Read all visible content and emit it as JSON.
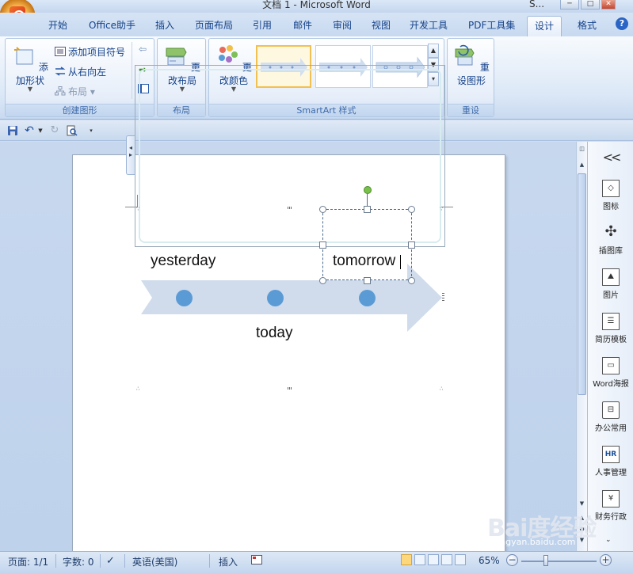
{
  "window": {
    "title": "文档 1 - Microsoft Word",
    "right_label": "S..."
  },
  "tabs": [
    {
      "label": "开始",
      "active": false
    },
    {
      "label": "Office助手",
      "active": false
    },
    {
      "label": "插入",
      "active": false
    },
    {
      "label": "页面布局",
      "active": false
    },
    {
      "label": "引用",
      "active": false
    },
    {
      "label": "邮件",
      "active": false
    },
    {
      "label": "审阅",
      "active": false
    },
    {
      "label": "视图",
      "active": false
    },
    {
      "label": "开发工具",
      "active": false
    },
    {
      "label": "PDF工具集",
      "active": false
    },
    {
      "label": "设计",
      "active": true
    },
    {
      "label": "格式",
      "active": false
    }
  ],
  "ribbon": {
    "create_graphic": {
      "label": "创建图形",
      "add_shape": "添加形状",
      "add_bullet": "添加项目符号",
      "right_to_left": "从右向左",
      "layout": "布局"
    },
    "layout_group": {
      "label": "布局",
      "change_layout": "更改布局"
    },
    "styles_group": {
      "label": "SmartArt 样式",
      "change_colors": "更改颜色"
    },
    "reset_group": {
      "label": "重设",
      "reset_graphic": "重设图形"
    }
  },
  "smartart": {
    "labels": {
      "yesterday": "yesterday",
      "today": "today",
      "tomorrow": "tomorrow"
    },
    "arrow_color": "#d0dcec",
    "dot_color": "#5b9bd5"
  },
  "right_panel": {
    "items": [
      {
        "label": "图标",
        "icon": "shapes-icon"
      },
      {
        "label": "插图库",
        "icon": "windmill-icon"
      },
      {
        "label": "图片",
        "icon": "picture-icon"
      },
      {
        "label": "简历模板",
        "icon": "resume-icon"
      },
      {
        "label": "Word海报",
        "icon": "poster-icon"
      },
      {
        "label": "办公常用",
        "icon": "briefcase-icon"
      },
      {
        "label": "人事管理",
        "icon": "hr-icon",
        "glyph": "HR"
      },
      {
        "label": "财务行政",
        "icon": "finance-icon",
        "glyph": "¥"
      }
    ]
  },
  "statusbar": {
    "page": "页面: 1/1",
    "words": "字数: 0",
    "language": "英语(美国)",
    "mode": "插入",
    "zoom": "65%"
  },
  "watermark": {
    "brand": "Bai度经验",
    "url": "jingyan.baidu.com"
  }
}
